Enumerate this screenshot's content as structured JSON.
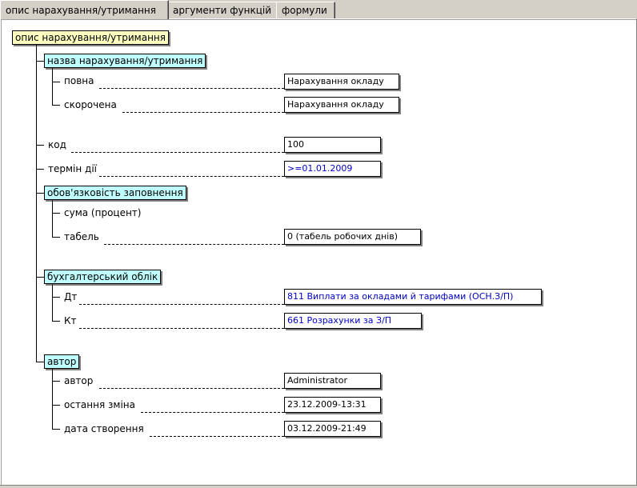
{
  "tabs": [
    "опис нарахування/утримання",
    "аргументи функцій",
    "формули"
  ],
  "root": "опис нарахування/утримання",
  "name_group": {
    "title": "назва нарахування/утримання",
    "full_label": "повна",
    "full_value": "Нарахування окладу",
    "short_label": "скорочена",
    "short_value": "Нарахування окладу"
  },
  "code": {
    "label": "код",
    "value": "100"
  },
  "term": {
    "label": "термін дії",
    "value": ">=01.01.2009"
  },
  "required": {
    "title": "обов'язковість заповнення",
    "sum_label": "сума (процент)",
    "table_label": "табель",
    "table_value": "0   (табель робочих днів)"
  },
  "accounting": {
    "title": "бухгалтерський облік",
    "dt_label": "Дт",
    "dt_value": "811 Виплати за окладами й тарифами (ОСН.З/П)",
    "kt_label": "Кт",
    "kt_value": "661 Розрахунки за З/П"
  },
  "author": {
    "title": "автор",
    "author_label": "автор",
    "author_value": "Administrator",
    "changed_label": "остання зміна",
    "changed_value": "23.12.2009-13:31",
    "created_label": "дата створення",
    "created_value": "03.12.2009-21:49"
  },
  "colors": {
    "root_bg": "#ffffc0",
    "group_bg": "#c0ffff",
    "link_value": "#0000c0"
  }
}
